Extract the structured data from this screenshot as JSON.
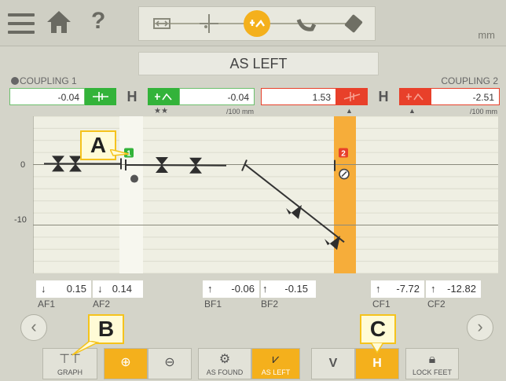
{
  "header": {
    "unit": "mm",
    "help_label": "?",
    "steps": [
      "dimensions-icon",
      "measure-icon",
      "results-icon",
      "shim-icon",
      "report-icon"
    ],
    "active_step": 2
  },
  "title": "AS LEFT",
  "coupling1": {
    "label": "COUPLING 1",
    "v_value": "-0.04",
    "h_letter": "H",
    "h_value": "-0.04",
    "stars": "★★",
    "unit": "/100 mm",
    "status_color": "#33b33a"
  },
  "coupling2": {
    "label": "COUPLING 2",
    "v_value": "1.53",
    "h_letter": "H",
    "h_value": "-2.51",
    "unit": "/100 mm",
    "status_color": "#e8402a"
  },
  "graph": {
    "tick_labels": [
      "0",
      "-10"
    ],
    "badge1": "1",
    "badge2": "2"
  },
  "chart_data": {
    "type": "line",
    "ylim": [
      -18,
      8
    ],
    "y_ticks": [
      0,
      -10
    ],
    "segments": [
      {
        "name": "machine-1",
        "x": [
          0,
          98
        ],
        "y": [
          0.15,
          0.14
        ]
      },
      {
        "name": "machine-2",
        "x": [
          104,
          232
        ],
        "y": [
          -0.06,
          -0.15
        ]
      },
      {
        "name": "machine-3",
        "x": [
          256,
          382
        ],
        "y": [
          0,
          -12.82
        ]
      }
    ],
    "feet": [
      {
        "label": "AF1",
        "x": 18,
        "y": 0.15
      },
      {
        "label": "AF2",
        "x": 40,
        "y": 0.14
      },
      {
        "label": "BF1",
        "x": 150,
        "y": -0.06
      },
      {
        "label": "BF2",
        "x": 193,
        "y": -0.15
      },
      {
        "label": "CF1",
        "x": 318,
        "y": -7.72
      },
      {
        "label": "CF2",
        "x": 367,
        "y": -12.82
      }
    ]
  },
  "readouts": [
    {
      "arrow": "↓",
      "value": "0.15",
      "label": "AF1"
    },
    {
      "arrow": "↓",
      "value": "0.14",
      "label": "AF2"
    },
    {
      "arrow": "↑",
      "value": "-0.06",
      "label": "BF1"
    },
    {
      "arrow": "↑",
      "value": "-0.15",
      "label": "BF2"
    },
    {
      "arrow": "↑",
      "value": "-7.72",
      "label": "CF1"
    },
    {
      "arrow": "↑",
      "value": "-12.82",
      "label": "CF2"
    }
  ],
  "nav": {
    "prev": "‹",
    "next": "›"
  },
  "toolbar": {
    "graph": "GRAPH",
    "as_found": "AS FOUND",
    "as_left": "AS LEFT",
    "v": "V",
    "h": "H",
    "lock_feet": "LOCK FEET"
  },
  "callouts": {
    "a": "A",
    "b": "B",
    "c": "C"
  },
  "colors": {
    "accent": "#f4b01c",
    "ok": "#33b33a",
    "bad": "#e8402a"
  }
}
